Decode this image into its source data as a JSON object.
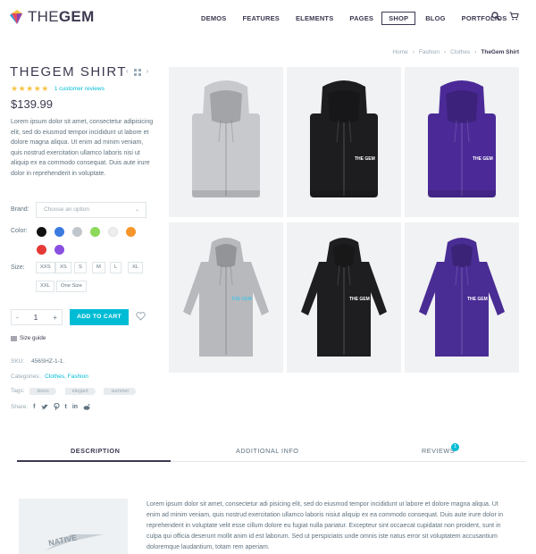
{
  "brand": {
    "name_prefix": "THE",
    "name_suffix": "GEM"
  },
  "nav": {
    "items": [
      "DEMOS",
      "FEATURES",
      "ELEMENTS",
      "PAGES",
      "SHOP",
      "BLOG",
      "PORTFOLIOS"
    ],
    "active": "SHOP"
  },
  "breadcrumb": [
    "Home",
    "Fashion",
    "Clothes",
    "TheGem Shirt"
  ],
  "product": {
    "title": "THEGEM SHIRT",
    "stars": "★★★★★",
    "reviews_link": "1 customer reviews",
    "price": "$139.99",
    "description": "Lorem ipsum dolor sit amet, consectetur adipisicing elit, sed do eiusmod tempor incididunt ut labore et dolore magna aliqua. Ut enim ad minim veniam, quis nostrud exercitation ullamco laboris nisi ut aliquip ex ea commodo consequat. Duis aute irure dolor in reprehenderit in voluptate."
  },
  "options": {
    "brand_label": "Brand:",
    "brand_placeholder": "Choose an option",
    "color_label": "Color:",
    "colors": [
      "#111111",
      "#3b7be0",
      "#bfc6cc",
      "#8cd85a",
      "#eeeeee",
      "#f6952a",
      "#e53935",
      "#8a4fe0"
    ],
    "size_label": "Size:",
    "sizes_row1": [
      "XXS",
      "XS",
      "S",
      "M",
      "L",
      "XL"
    ],
    "sizes_row2": [
      "XXL",
      "One Size"
    ]
  },
  "cart": {
    "quantity": "1",
    "minus": "-",
    "plus": "+",
    "add_to_cart": "ADD TO CART",
    "size_guide": "Size guide"
  },
  "meta": {
    "sku_label": "SKU:",
    "sku": "456SHZ-1-1.",
    "categories_label": "Categories:",
    "categories": [
      "Clothes",
      "Fashion"
    ],
    "tags_label": "Tags:",
    "tags": [
      "dress",
      "elegant",
      "summer"
    ],
    "share_label": "Share:"
  },
  "gallery": {
    "logo_text": "THE GEM",
    "colors": [
      "#c7c9cd",
      "#1d1d1f",
      "#4b2a98",
      "#b7b9bd",
      "#1e1e20",
      "#4a2c95"
    ]
  },
  "tabs": {
    "description": "DESCRIPTION",
    "additional": "ADDITIONAL INFO",
    "reviews": "REVIEWS",
    "reviews_count": "1"
  },
  "description_tab": {
    "image_text": "NATIVE",
    "text": "Lorem ipsum dolor sit amet, consectetur adi pisicing elit, sed do eiusmod tempor incididunt ut labore et dolore magna aliqua. Ut enim ad minim veniam, quis nostrud exercitation ullamco laboris nisiut aliquip ex ea commodo consequat. Duis aute irure dolor in reprehenderit in voluptate velit esse cillum dolore eu fugiat nulla pariatur. Excepteur sint occaecat cupidatat non proident, sunt in culpa qui officia deserunt mollit anim id est laborum. Sed ut perspiciatis unde omnis iste natus error sit voluptatem accusantium doloremque laudantium, totam rem aperiam."
  }
}
